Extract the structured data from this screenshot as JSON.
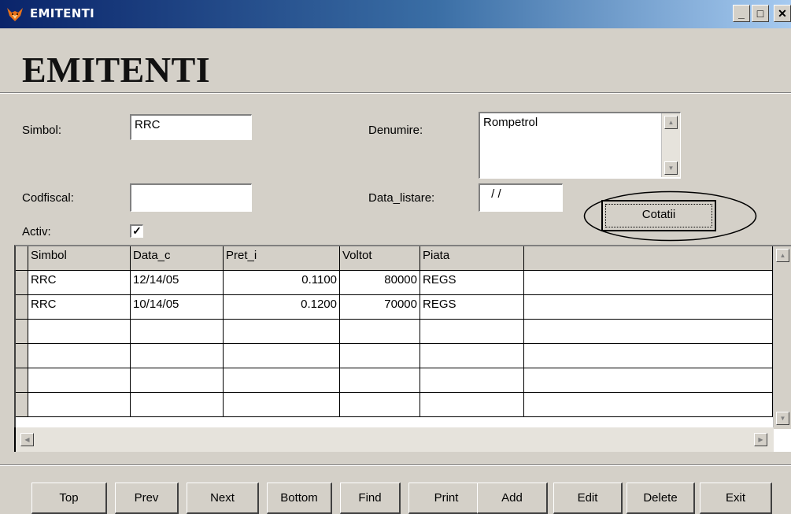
{
  "window": {
    "title": "EMITENTI",
    "controls": {
      "minimize": "_",
      "maximize": "□",
      "close": "✕"
    }
  },
  "form": {
    "heading": "EMITENTI",
    "simbol": {
      "label": "Simbol:",
      "value": "RRC"
    },
    "denumire": {
      "label": "Denumire:",
      "value": "Rompetrol"
    },
    "codfiscal": {
      "label": "Codfiscal:",
      "value": ""
    },
    "data_listare": {
      "label": "Data_listare:",
      "value": " / /"
    },
    "activ": {
      "label": "Activ:",
      "checked": true,
      "mark": "✓"
    },
    "cotatii_button": "Cotatii"
  },
  "grid": {
    "columns": [
      "Simbol",
      "Data_c",
      "Pret_i",
      "Voltot",
      "Piata"
    ],
    "rows": [
      [
        "RRC",
        "12/14/05",
        "0.1100",
        "80000",
        "REGS"
      ],
      [
        "RRC",
        "10/14/05",
        "0.1200",
        "70000",
        "REGS"
      ]
    ]
  },
  "nav_buttons": [
    {
      "label": "Top"
    },
    {
      "label": "Prev"
    },
    {
      "label": "Next"
    },
    {
      "label": "Bottom"
    },
    {
      "label": "Find"
    },
    {
      "label": "Print"
    },
    {
      "label": "Add"
    },
    {
      "label": "Edit"
    },
    {
      "label": "Delete"
    },
    {
      "label": "Exit"
    }
  ]
}
